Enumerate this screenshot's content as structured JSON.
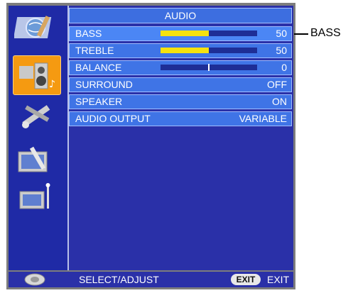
{
  "menu": {
    "title": "AUDIO",
    "rows": [
      {
        "label": "BASS",
        "value": "50",
        "bar_level": 0.5
      },
      {
        "label": "TREBLE",
        "value": "50",
        "bar_level": 0.5
      },
      {
        "label": "BALANCE",
        "value": "0",
        "bar_level": 0.5
      },
      {
        "label": "SURROUND",
        "value": "OFF"
      },
      {
        "label": "SPEAKER",
        "value": "ON"
      },
      {
        "label": "AUDIO OUTPUT",
        "value": "VARIABLE"
      }
    ]
  },
  "sidebar": {
    "icons": [
      {
        "name": "picture-globe-icon"
      },
      {
        "name": "audio-speaker-icon",
        "selected": true
      },
      {
        "name": "setup-tools-icon"
      },
      {
        "name": "tv-settings-icon"
      },
      {
        "name": "tv-antenna-icon"
      }
    ]
  },
  "footer": {
    "select_label": "SELECT/ADJUST",
    "exit_key": "EXIT",
    "exit_label": "EXIT"
  },
  "callout": {
    "label": "BASS"
  },
  "colors": {
    "panel": "#2a30a8",
    "row": "#3f74e6",
    "bar_fill": "#f5e20e",
    "selected_icon": "#f59a11"
  }
}
